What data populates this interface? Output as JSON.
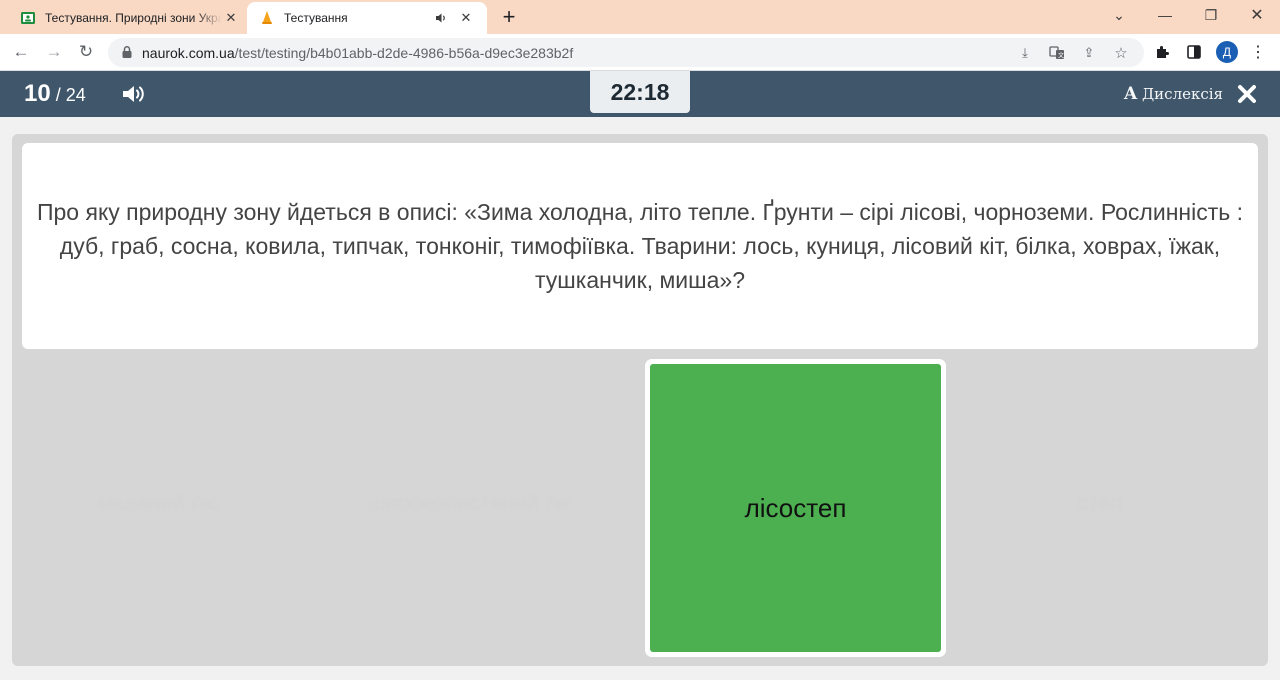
{
  "browser": {
    "tabs": [
      {
        "title": "Тестування. Природні зони України",
        "favicon": "google-classroom-icon",
        "active": false
      },
      {
        "title": "Тестування",
        "favicon": "naurok-icon",
        "active": true,
        "audio": "speaker-icon"
      }
    ],
    "new_tab_label": "+",
    "url_host": "naurok.com.ua",
    "url_path": "/test/testing/b4b01abb-d2de-4986-b56a-d9ec3e283b2f",
    "profile_initial": "Д"
  },
  "header": {
    "current_question": "10",
    "separator": " / ",
    "total_questions": "24",
    "timer": "22:18",
    "dyslexia_glyph": "A",
    "dyslexia_label": "Дислексія"
  },
  "question": {
    "text": "Про яку природну зону йдеться в описі: «Зима холодна, літо тепле. Ґрунти – сірі лісові, чорноземи. Рослинність : дуб, граб, сосна, ковила, типчак, тонконіг, тимофіївка. Тварини: лось, куниця, лісовий кіт, білка, ховрах, їжак, тушканчик, миша»?"
  },
  "options": {
    "ghost": [
      "мішаний ліс",
      "широколистяний ліс",
      "степ"
    ],
    "selected": "лісостеп"
  },
  "colors": {
    "tabstrip": "#f9d8c4",
    "appbar": "#3f566b",
    "answer_green": "#4caf50",
    "stage": "#d6d6d6"
  }
}
